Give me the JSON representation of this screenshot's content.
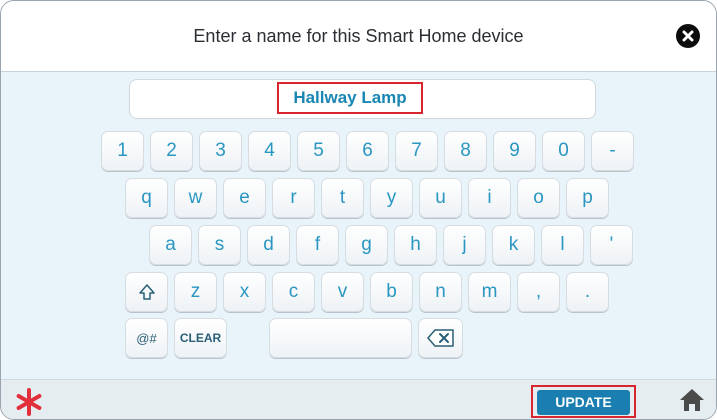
{
  "header": {
    "title": "Enter a name for this Smart Home device"
  },
  "name_field": {
    "value": "Hallway Lamp"
  },
  "keyboard": {
    "row1": [
      "1",
      "2",
      "3",
      "4",
      "5",
      "6",
      "7",
      "8",
      "9",
      "0",
      "-"
    ],
    "row2": [
      "q",
      "w",
      "e",
      "r",
      "t",
      "y",
      "u",
      "i",
      "o",
      "p"
    ],
    "row3": [
      "a",
      "s",
      "d",
      "f",
      "g",
      "h",
      "j",
      "k",
      "l",
      "'"
    ],
    "row4": [
      "z",
      "x",
      "c",
      "v",
      "b",
      "n",
      "m",
      ",",
      "."
    ],
    "row5": {
      "symbols_label": "@#",
      "clear_label": "CLEAR"
    }
  },
  "footer": {
    "update_label": "UPDATE"
  },
  "colors": {
    "accent": "#1a7fb0",
    "key_text": "#2a97c2",
    "highlight_box": "#d7262d",
    "asterisk": "#e1303b"
  },
  "icons": {
    "close": "close-icon",
    "shift": "shift-arrow-icon",
    "backspace": "backspace-icon",
    "home": "home-icon",
    "asterisk": "asterisk-icon"
  }
}
